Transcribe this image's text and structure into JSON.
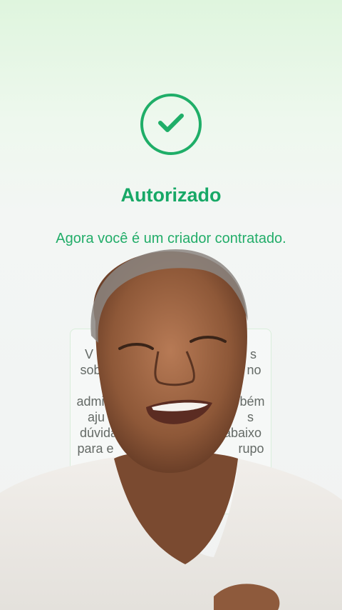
{
  "status": {
    "title": "Autorizado",
    "subtitle": "Agora você é um criador contratado."
  },
  "info_card": {
    "line1": "V",
    "line1_right": "s",
    "line2": "sob",
    "line2_right": "no",
    "line3": "admin",
    "line3_right": "bém",
    "line4": "aju",
    "line4_right": "s",
    "line5": "dúvidas",
    "line5_right": "abaixo",
    "line6": "para e",
    "line6_right": "rupo"
  },
  "colors": {
    "accent": "#1fae68",
    "text_muted": "#646a66"
  },
  "icons": {
    "status_icon": "check-circle-icon"
  }
}
